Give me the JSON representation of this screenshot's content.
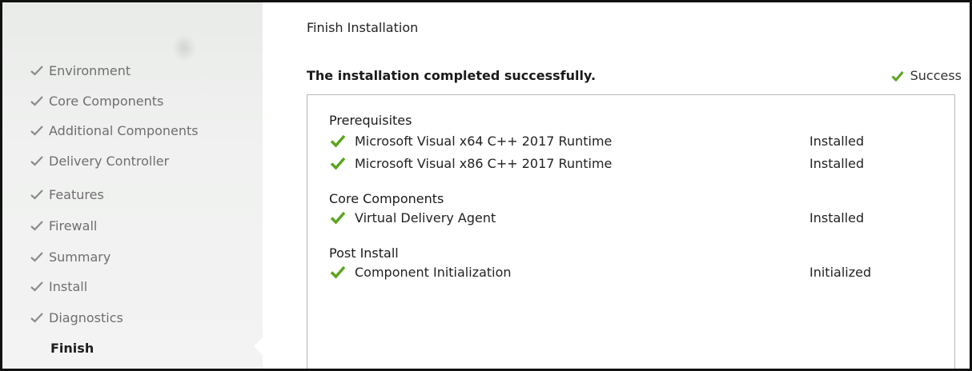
{
  "sidebar": {
    "items": [
      {
        "label": "Environment",
        "done": true
      },
      {
        "label": "Core Components",
        "done": true
      },
      {
        "label": "Additional Components",
        "done": true
      },
      {
        "label": "Delivery Controller",
        "done": true
      },
      {
        "label": "Features",
        "done": true
      },
      {
        "label": "Firewall",
        "done": true
      },
      {
        "label": "Summary",
        "done": true
      },
      {
        "label": "Install",
        "done": true
      },
      {
        "label": "Diagnostics",
        "done": true
      },
      {
        "label": "Finish",
        "done": false,
        "current": true
      }
    ]
  },
  "main": {
    "title": "Finish Installation",
    "headline": "The installation completed successfully.",
    "status_label": "Success",
    "sections": [
      {
        "title": "Prerequisites",
        "items": [
          {
            "name": "Microsoft Visual x64 C++ 2017 Runtime",
            "state": "Installed"
          },
          {
            "name": "Microsoft Visual x86 C++ 2017 Runtime",
            "state": "Installed"
          }
        ]
      },
      {
        "title": "Core Components",
        "items": [
          {
            "name": "Virtual Delivery Agent",
            "state": "Installed"
          }
        ]
      },
      {
        "title": "Post Install",
        "items": [
          {
            "name": "Component Initialization",
            "state": "Initialized"
          }
        ]
      }
    ]
  },
  "icons": {
    "nav_check": "checkmark-icon",
    "success_check": "checkmark-icon"
  },
  "colors": {
    "success_green": "#5aa51d",
    "nav_check_gray": "#8a8a8a"
  }
}
